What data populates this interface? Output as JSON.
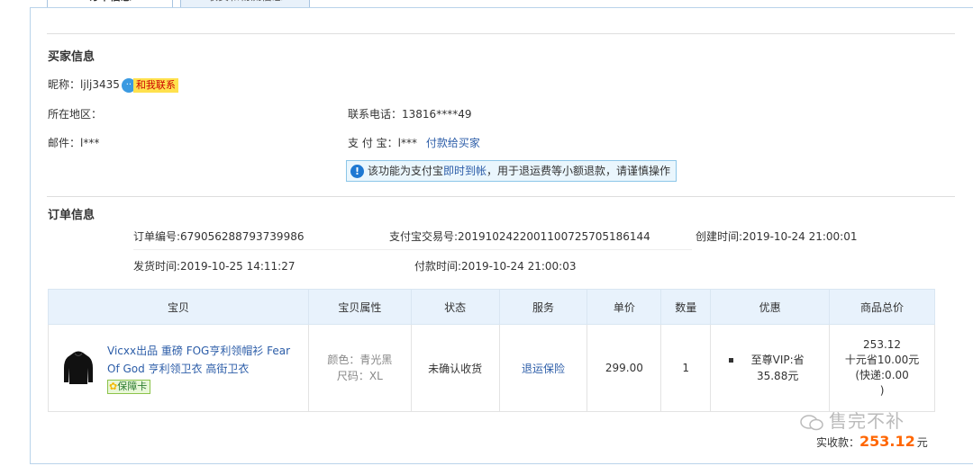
{
  "tabs": [
    {
      "label": "订单信息",
      "active": true
    },
    {
      "label": "收货和物流信息",
      "active": false
    }
  ],
  "buyer": {
    "section_title": "买家信息",
    "nickname_label": "昵称：",
    "nickname": "ljlj3435",
    "contact_me": "和我联系",
    "region_label": "所在地区：",
    "region": "",
    "phone_label": "联系电话：",
    "phone": "13816****49",
    "email_label": "邮件：",
    "email": "l***",
    "alipay_label": "支 付 宝：",
    "alipay": "l***",
    "pay_buyer_link": "付款给买家",
    "notice_pre": "该功能为支付宝",
    "notice_link": "即时到帐",
    "notice_post": "，用于退运费等小额退款，请谨慎操作"
  },
  "order": {
    "section_title": "订单信息",
    "order_no": "订单编号:679056288793739986",
    "alipay_trade_no": "支付宝交易号:2019102422001100725705186144",
    "created_time": "创建时间:2019-10-24 21:00:01",
    "ship_time": "发货时间:2019-10-25 14:11:27",
    "pay_time": "付款时间:2019-10-24 21:00:03"
  },
  "table": {
    "headers": [
      "宝贝",
      "宝贝属性",
      "状态",
      "服务",
      "单价",
      "数量",
      "优惠",
      "商品总价"
    ],
    "row": {
      "title": "Vicxx出品 重磅 FOG亨利领帽衫 Fear Of God 亨利领卫衣 高街卫衣",
      "guarantee": "保障卡",
      "attr_color": "颜色：青光黑",
      "attr_size": "尺码：XL",
      "status": "未确认收货",
      "service": "退运保险",
      "price": "299.00",
      "qty": "1",
      "discount": "至尊VIP:省 35.88元",
      "total_line1": "253.12",
      "total_line2": "十元省10.00元",
      "total_line3": "(快递:0.00",
      "total_line4": ")"
    }
  },
  "payment": {
    "label": "实收款：",
    "amount": "253.12",
    "unit": "元"
  },
  "watermark": "售完不补",
  "colors": {
    "link": "#2c5da8",
    "accent_orange": "#ff6600",
    "header_bg": "#e8f2fc"
  }
}
